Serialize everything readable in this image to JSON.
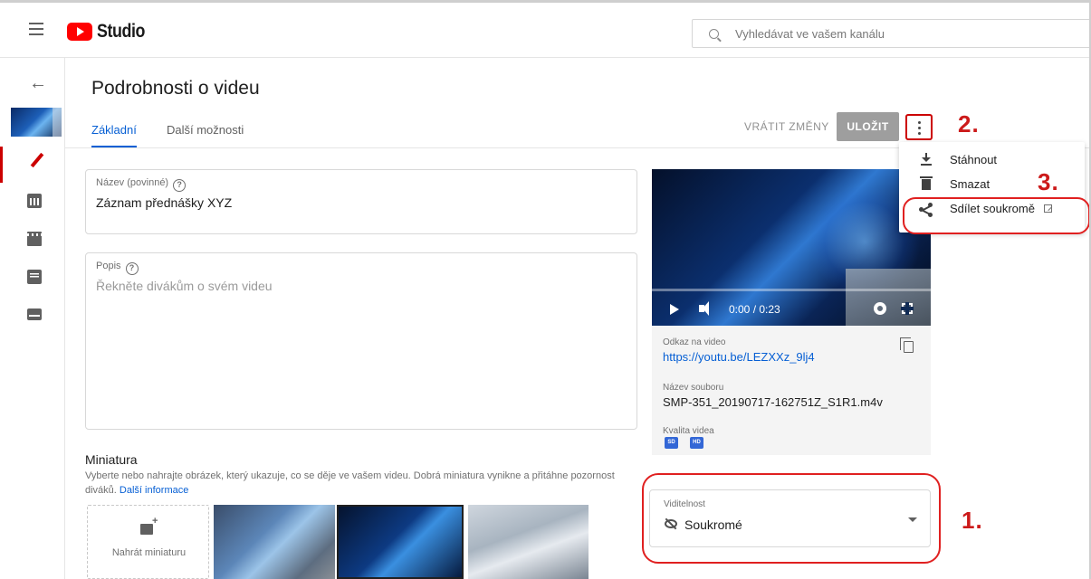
{
  "topbar": {
    "logo_text": "Studio",
    "search_placeholder": "Vyhledávat ve vašem kanálu"
  },
  "page": {
    "title": "Podrobnosti o videu",
    "tabs": [
      {
        "label": "Základní",
        "active": true
      },
      {
        "label": "Další možnosti",
        "active": false
      }
    ],
    "revert_label": "VRÁTIT ZMĚNY",
    "save_label": "ULOŽIT"
  },
  "form": {
    "title_label": "Název (povinné)",
    "title_value": "Záznam přednášky XYZ",
    "desc_label": "Popis",
    "desc_placeholder": "Řekněte divákům o svém videu"
  },
  "thumbnail": {
    "heading": "Miniatura",
    "description": "Vyberte nebo nahrajte obrázek, který ukazuje, co se děje ve vašem videu. Dobrá miniatura vynikne a přitáhne pozornost diváků.",
    "link": "Další informace",
    "upload_label": "Nahrát miniaturu"
  },
  "video": {
    "time": "0:00 / 0:23",
    "link_label": "Odkaz na video",
    "link_value": "https://youtu.be/LEZXXz_9lj4",
    "filename_label": "Název souboru",
    "filename_value": "SMP-351_20190717-162751Z_S1R1.m4v",
    "quality_label": "Kvalita videa",
    "quality_badges": [
      "SD",
      "HD"
    ]
  },
  "visibility": {
    "label": "Viditelnost",
    "value": "Soukromé"
  },
  "menu": {
    "items": [
      {
        "label": "Stáhnout",
        "icon": "download-icon"
      },
      {
        "label": "Smazat",
        "icon": "trash-icon"
      },
      {
        "label": "Sdílet soukromě",
        "icon": "share-icon"
      }
    ]
  },
  "annotations": {
    "one": "1.",
    "two": "2.",
    "three": "3.",
    "color": "#cc1a1a"
  },
  "colors": {
    "accent": "#065fd4",
    "brand": "#ff0000",
    "annotation_red": "#e02020"
  }
}
